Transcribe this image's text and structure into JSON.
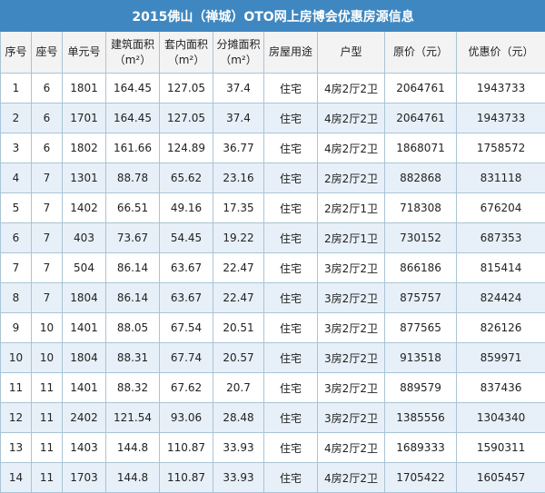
{
  "title": "2015佛山（禅城）OTO网上房博会优惠房源信息",
  "headers": [
    {
      "line1": "序号",
      "line2": ""
    },
    {
      "line1": "座号",
      "line2": ""
    },
    {
      "line1": "单元号",
      "line2": ""
    },
    {
      "line1": "建筑面积",
      "line2": "（m²）"
    },
    {
      "line1": "套内面积",
      "line2": "（m²）"
    },
    {
      "line1": "分摊面积",
      "line2": "（m²）"
    },
    {
      "line1": "房屋用途",
      "line2": ""
    },
    {
      "line1": "户型",
      "line2": ""
    },
    {
      "line1": "原价（元）",
      "line2": ""
    },
    {
      "line1": "优惠价（元）",
      "line2": ""
    }
  ],
  "rows": [
    [
      "1",
      "6",
      "1801",
      "164.45",
      "127.05",
      "37.4",
      "住宅",
      "4房2厅2卫",
      "2064761",
      "1943733"
    ],
    [
      "2",
      "6",
      "1701",
      "164.45",
      "127.05",
      "37.4",
      "住宅",
      "4房2厅2卫",
      "2064761",
      "1943733"
    ],
    [
      "3",
      "6",
      "1802",
      "161.66",
      "124.89",
      "36.77",
      "住宅",
      "4房2厅2卫",
      "1868071",
      "1758572"
    ],
    [
      "4",
      "7",
      "1301",
      "88.78",
      "65.62",
      "23.16",
      "住宅",
      "2房2厅2卫",
      "882868",
      "831118"
    ],
    [
      "5",
      "7",
      "1402",
      "66.51",
      "49.16",
      "17.35",
      "住宅",
      "2房2厅1卫",
      "718308",
      "676204"
    ],
    [
      "6",
      "7",
      "403",
      "73.67",
      "54.45",
      "19.22",
      "住宅",
      "2房2厅1卫",
      "730152",
      "687353"
    ],
    [
      "7",
      "7",
      "504",
      "86.14",
      "63.67",
      "22.47",
      "住宅",
      "3房2厅2卫",
      "866186",
      "815414"
    ],
    [
      "8",
      "7",
      "1804",
      "86.14",
      "63.67",
      "22.47",
      "住宅",
      "3房2厅2卫",
      "875757",
      "824424"
    ],
    [
      "9",
      "10",
      "1401",
      "88.05",
      "67.54",
      "20.51",
      "住宅",
      "3房2厅2卫",
      "877565",
      "826126"
    ],
    [
      "10",
      "10",
      "1804",
      "88.31",
      "67.74",
      "20.57",
      "住宅",
      "3房2厅2卫",
      "913518",
      "859971"
    ],
    [
      "11",
      "11",
      "1401",
      "88.32",
      "67.62",
      "20.7",
      "住宅",
      "3房2厅2卫",
      "889579",
      "837436"
    ],
    [
      "12",
      "11",
      "2402",
      "121.54",
      "93.06",
      "28.48",
      "住宅",
      "3房2厅2卫",
      "1385556",
      "1304340"
    ],
    [
      "13",
      "11",
      "1403",
      "144.8",
      "110.87",
      "33.93",
      "住宅",
      "4房2厅2卫",
      "1689333",
      "1590311"
    ],
    [
      "14",
      "11",
      "1703",
      "144.8",
      "110.87",
      "33.93",
      "住宅",
      "4房2厅2卫",
      "1705422",
      "1605457"
    ]
  ]
}
